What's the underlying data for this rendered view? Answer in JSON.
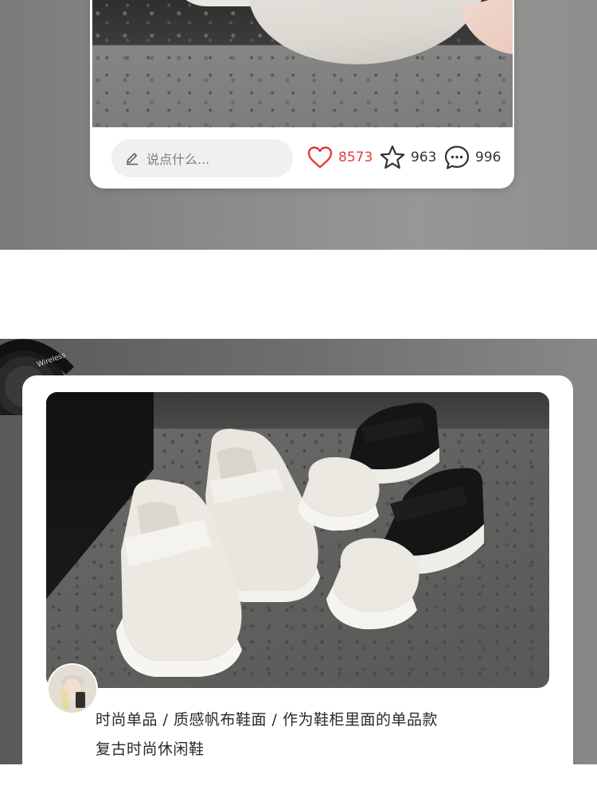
{
  "top_post": {
    "comment_placeholder": "说点什么...",
    "likes": "8573",
    "favorites": "963",
    "comments": "996",
    "like_color": "#e33b3b"
  },
  "bottom_post": {
    "headphone_text": "Wireless",
    "caption_line1": "时尚单品 / 质感帆布鞋面 / 作为鞋柜里面的单品款",
    "caption_line2": "复古时尚休闲鞋"
  }
}
